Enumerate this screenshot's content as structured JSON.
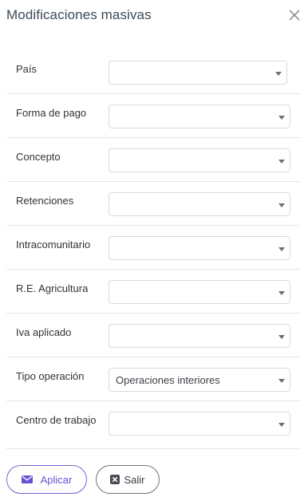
{
  "dialog": {
    "title": "Modificaciones masivas",
    "close_icon": "close-icon"
  },
  "fields": [
    {
      "label": "País",
      "value": ""
    },
    {
      "label": "Forma de pago",
      "value": ""
    },
    {
      "label": "Concepto",
      "value": ""
    },
    {
      "label": "Retenciones",
      "value": ""
    },
    {
      "label": "Intracomunitario",
      "value": ""
    },
    {
      "label": "R.E. Agricultura",
      "value": ""
    },
    {
      "label": "Iva aplicado",
      "value": ""
    },
    {
      "label": "Tipo operación",
      "value": "Operaciones interiores"
    },
    {
      "label": "Centro de trabajo",
      "value": ""
    }
  ],
  "actions": {
    "apply_label": "Aplicar",
    "apply_icon": "envelope-icon",
    "exit_label": "Salir",
    "exit_icon": "close-box-icon"
  },
  "colors": {
    "accent": "#6a4fd0",
    "border": "#d6dadf",
    "divider": "#e4e6e9"
  }
}
